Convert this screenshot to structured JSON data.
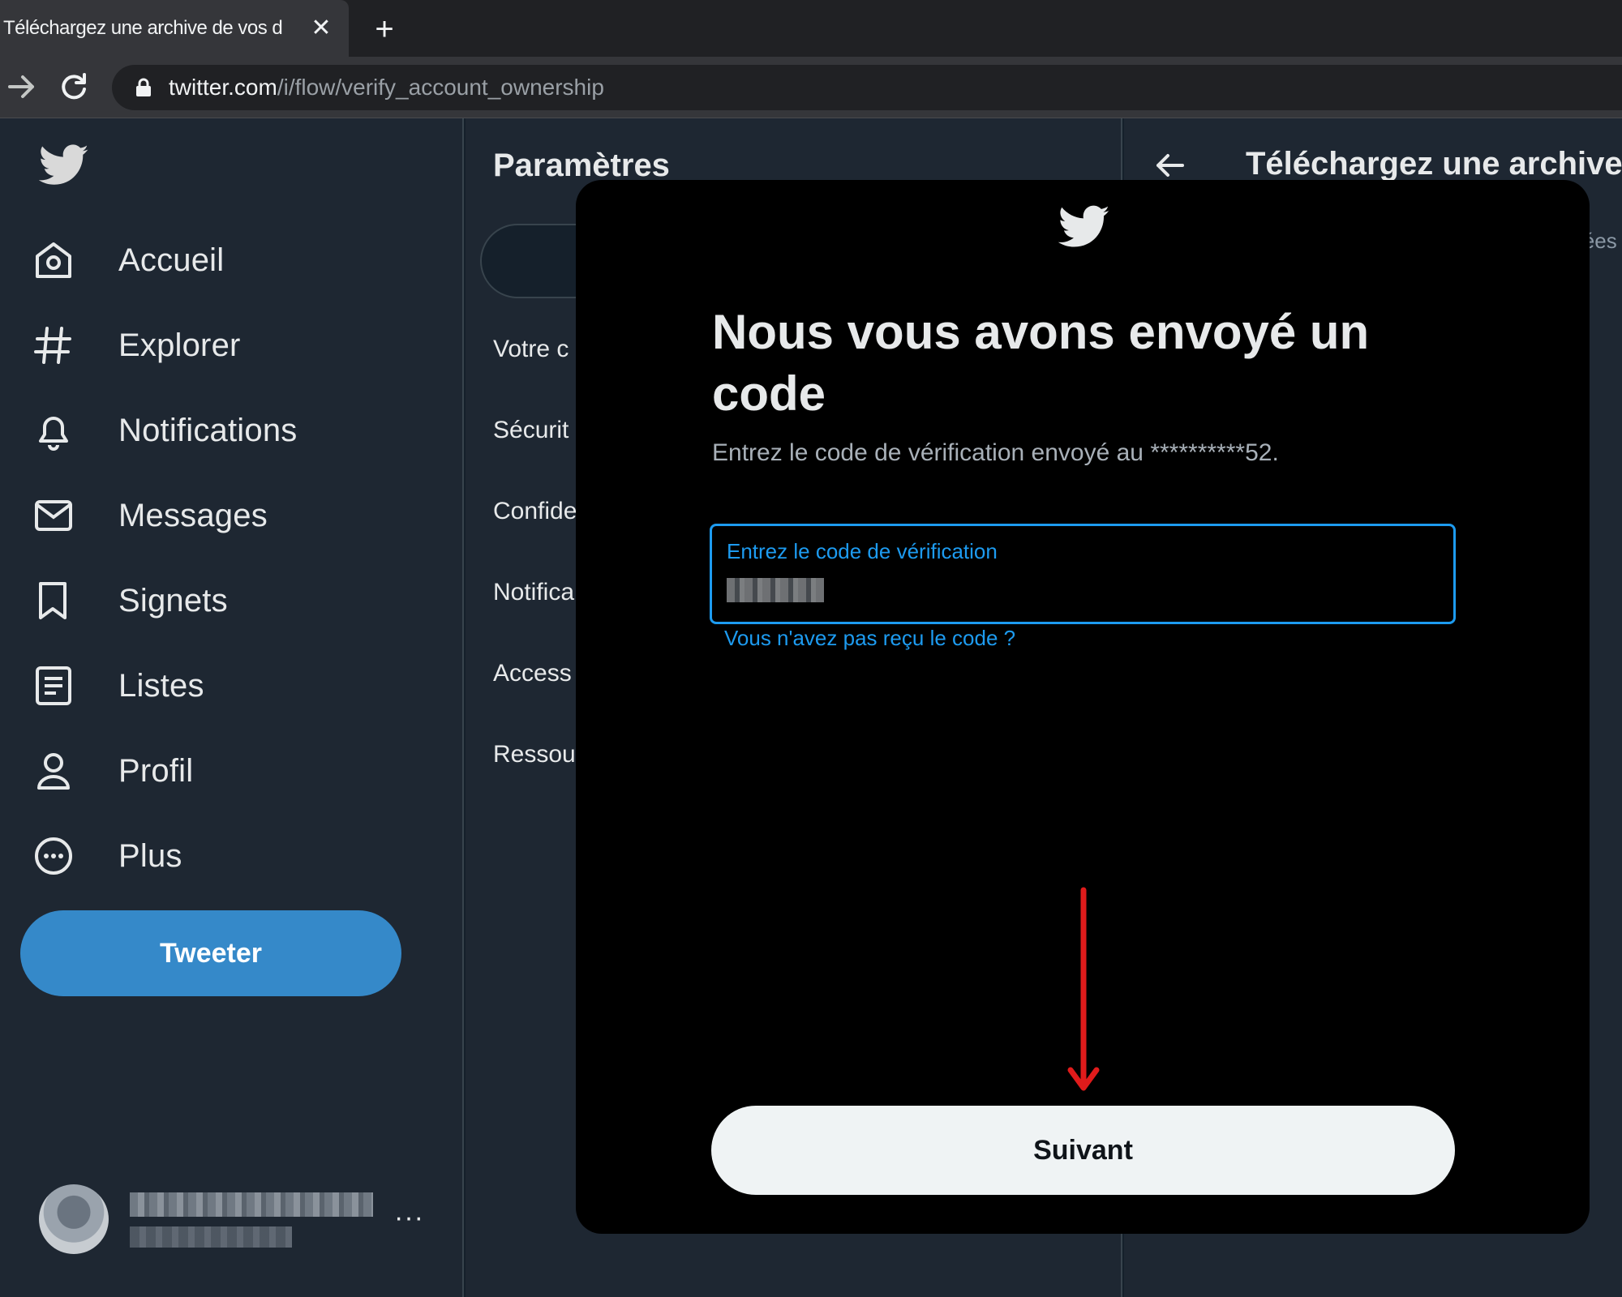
{
  "browser": {
    "tab_title": "Téléchargez une archive de vos d",
    "tab_close": "✕",
    "new_tab": "+",
    "url_host": "twitter.com",
    "url_path": "/i/flow/verify_account_ownership"
  },
  "sidebar": {
    "items": [
      {
        "label": "Accueil",
        "icon": "home-icon"
      },
      {
        "label": "Explorer",
        "icon": "hashtag-icon"
      },
      {
        "label": "Notifications",
        "icon": "bell-icon"
      },
      {
        "label": "Messages",
        "icon": "mail-icon"
      },
      {
        "label": "Signets",
        "icon": "bookmark-icon"
      },
      {
        "label": "Listes",
        "icon": "list-icon"
      },
      {
        "label": "Profil",
        "icon": "profile-icon"
      },
      {
        "label": "Plus",
        "icon": "more-circle-icon"
      }
    ],
    "tweet_button": "Tweeter",
    "account_more": "···"
  },
  "settings": {
    "title": "Paramètres",
    "items": [
      "Votre c",
      "Sécurit",
      "Confide",
      "Notifica",
      "Access",
      "Ressou"
    ]
  },
  "detail": {
    "title": "Téléchargez une archive",
    "subtitle_fragment": "iées"
  },
  "modal": {
    "heading": "Nous vous avons envoyé un code",
    "subtitle": "Entrez le code de vérification envoyé au **********52.",
    "field_label": "Entrez le code de vérification",
    "resend_link": "Vous n'avez pas reçu le code ?",
    "next_button": "Suivant"
  },
  "colors": {
    "accent": "#1d9bf0",
    "tweet_button": "#3589c9",
    "annotation_arrow": "#e01b1b",
    "modal_bg": "#000000",
    "page_bg": "#1e2732"
  }
}
